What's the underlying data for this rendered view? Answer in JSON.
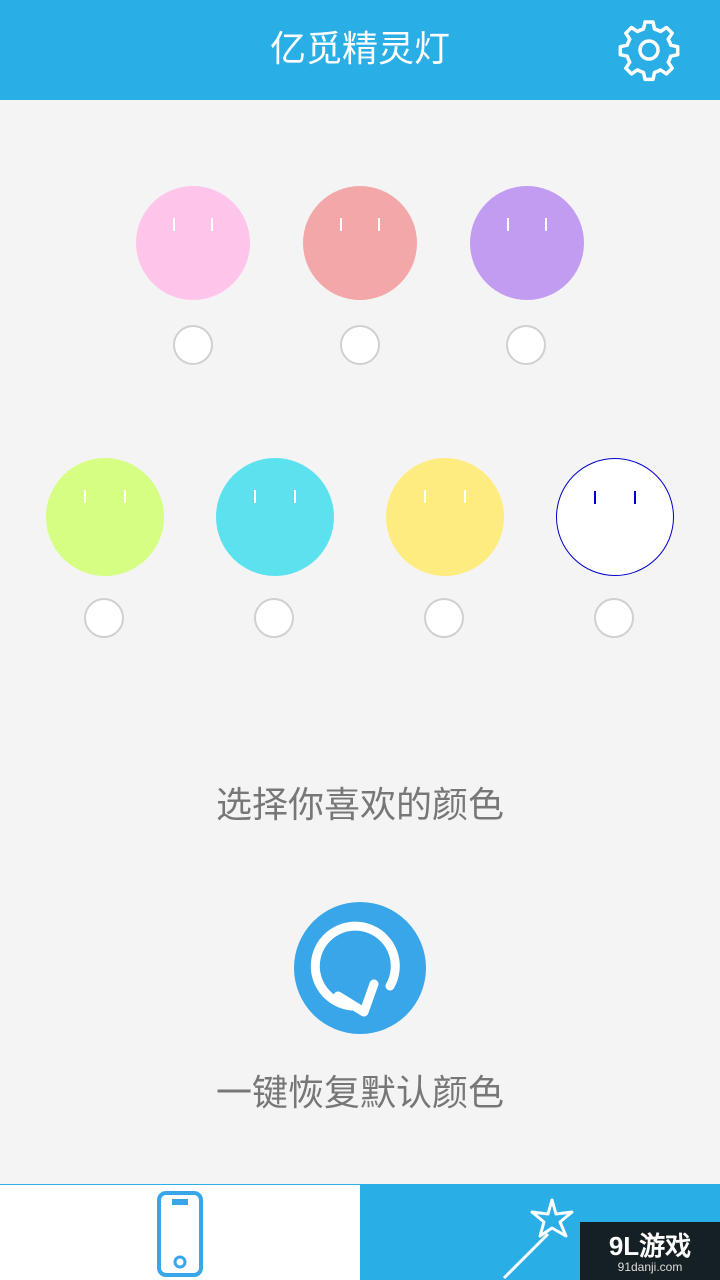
{
  "header": {
    "title": "亿觅精灵灯",
    "settings_icon": "gear-icon"
  },
  "colors": {
    "header_blue": "#2aaee6",
    "button_blue": "#3aa6ea",
    "background": "#f4f4f4"
  },
  "palette_row1": [
    {
      "name": "pink",
      "color": "#ffc4ea",
      "eye": "#ffffff"
    },
    {
      "name": "salmon",
      "color": "#f3a7a8",
      "eye": "#ffffff"
    },
    {
      "name": "lavender",
      "color": "#c29cf1",
      "eye": "#ffffff"
    }
  ],
  "palette_row2": [
    {
      "name": "lime",
      "color": "#d5fe83",
      "eye": "#ffffff"
    },
    {
      "name": "cyan",
      "color": "#5ce2ef",
      "eye": "#ffffff"
    },
    {
      "name": "yellow",
      "color": "#ffec80",
      "eye": "#ffffff"
    },
    {
      "name": "white",
      "color": "#ffffff",
      "eye": "#0000cc",
      "border": "#0000cc"
    }
  ],
  "main": {
    "choose_label": "选择你喜欢的颜色",
    "reset_label": "一键恢复默认颜色",
    "reset_icon": "refresh-icon"
  },
  "tabbar": {
    "left_icon": "phone-icon",
    "right_icon": "magic-wand-icon"
  },
  "watermark": {
    "main": "9L游戏",
    "sub": "91danji.com"
  }
}
